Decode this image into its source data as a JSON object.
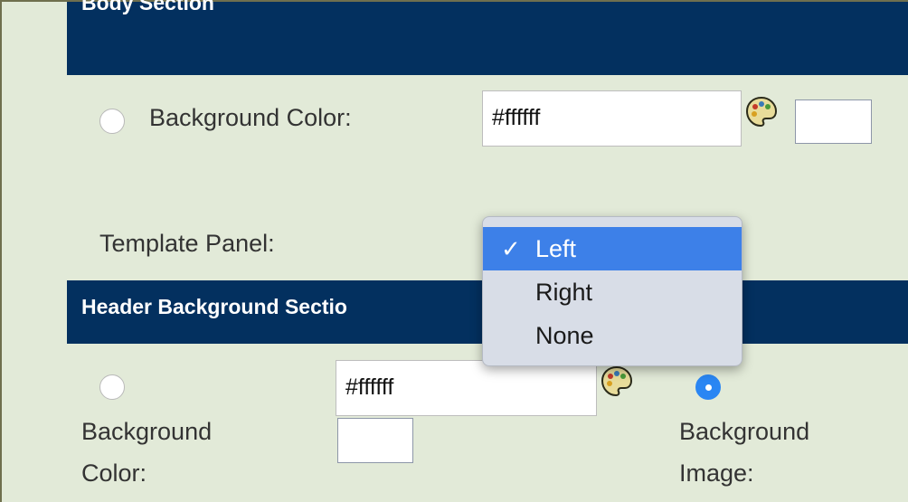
{
  "body_section": {
    "title": "Body Section",
    "background_color_label": "Background Color:",
    "background_color_value": "#ffffff",
    "template_panel_label": "Template Panel:",
    "template_panel": {
      "options": [
        "Left",
        "Right",
        "None"
      ],
      "selected": "Left",
      "check_mark": "✓"
    }
  },
  "header_background_section": {
    "title": "Header Background Section",
    "visible_title": "Header Background Sectio",
    "background_color_label_line1": "Background",
    "background_color_label_line2": "Color:",
    "background_color_value": "#ffffff",
    "background_image_label_line1": "Background",
    "background_image_label_line2": "Image:",
    "selected_option": "Background Image"
  },
  "colors": {
    "page_bg": "#e2ead8",
    "section_header_bg": "#03305f",
    "radio_checked": "#2a86f3",
    "dropdown_highlight": "#3d80e8"
  },
  "icons": [
    "palette-icon",
    "check-icon"
  ]
}
